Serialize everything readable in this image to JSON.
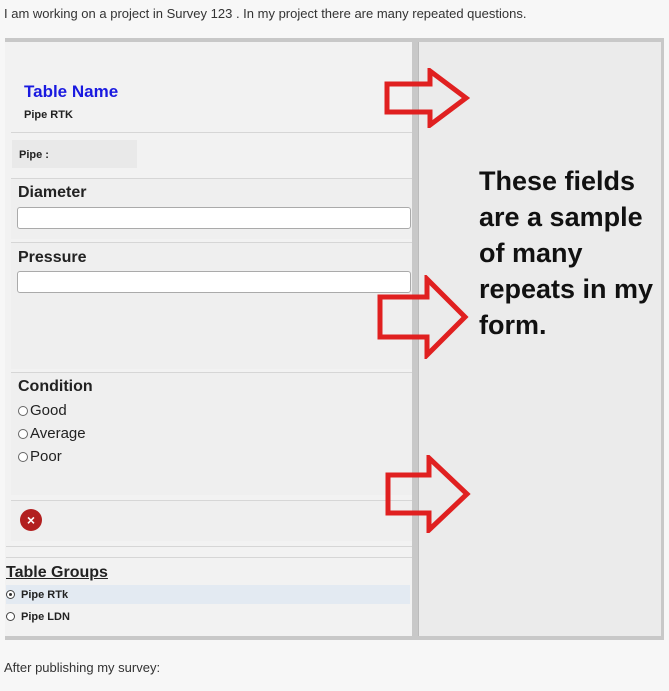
{
  "intro_text": "I am working on a project in Survey 123 . In my project there are many repeated questions.",
  "outro_text": "After publishing my survey:",
  "form": {
    "table_name_title": "Table Name",
    "table_name_value": "Pipe RTK",
    "pipe_label": "Pipe :",
    "diameter_label": "Diameter",
    "diameter_value": "",
    "pressure_label": "Pressure",
    "pressure_value": "",
    "condition_label": "Condition",
    "condition_options": [
      "Good",
      "Average",
      "Poor"
    ],
    "delete_icon": "×",
    "groups_title": "Table Groups",
    "groups": [
      {
        "label": "Pipe RTk",
        "selected": true
      },
      {
        "label": "Pipe LDN",
        "selected": false
      }
    ]
  },
  "annotation": {
    "text": "These fields are a sample of many repeats in my form.",
    "arrow_color": "#e02020"
  }
}
